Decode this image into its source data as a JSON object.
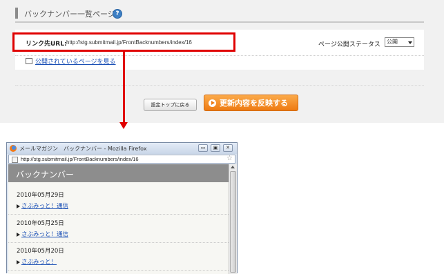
{
  "admin": {
    "section_title": "バックナンバー一覧ページ",
    "help_icon": "?",
    "link_url_label": "リンク先URL:",
    "link_url_value": "http://stg.submitmail.jp/FrontBacknumbers/index/16",
    "status_label": "ページ公開ステータス",
    "status_value": "公開",
    "view_link": "公開されているページを見る",
    "back_button": "設定トップに戻る",
    "apply_button": "更新内容を反映する"
  },
  "browser": {
    "window_title": "メールマガジン　バックナンバー - Mozilla Firefox",
    "address": "http://stg.submitmail.jp/FrontBacknumbers/index/16",
    "minimize_glyph": "▭",
    "maximize_glyph": "▣",
    "close_glyph": "✕",
    "star_glyph": "☆",
    "page_title": "バックナンバー",
    "entries": [
      {
        "date": "2010年05月29日",
        "link": "さぶみっと！通信"
      },
      {
        "date": "2010年05月25日",
        "link": "さぶみっと！通信"
      },
      {
        "date": "2010年05月20日",
        "link": "さぶみっと！"
      }
    ]
  },
  "icons": {
    "help": "help-icon",
    "page": "page-icon",
    "play": "play-icon",
    "firefox": "firefox-logo-icon",
    "star": "bookmark-star-icon"
  },
  "colors": {
    "highlight_red": "#e00000",
    "apply_orange": "#ee7a12",
    "link_blue": "#1a4fb5",
    "header_gray": "#8d8d8d"
  }
}
